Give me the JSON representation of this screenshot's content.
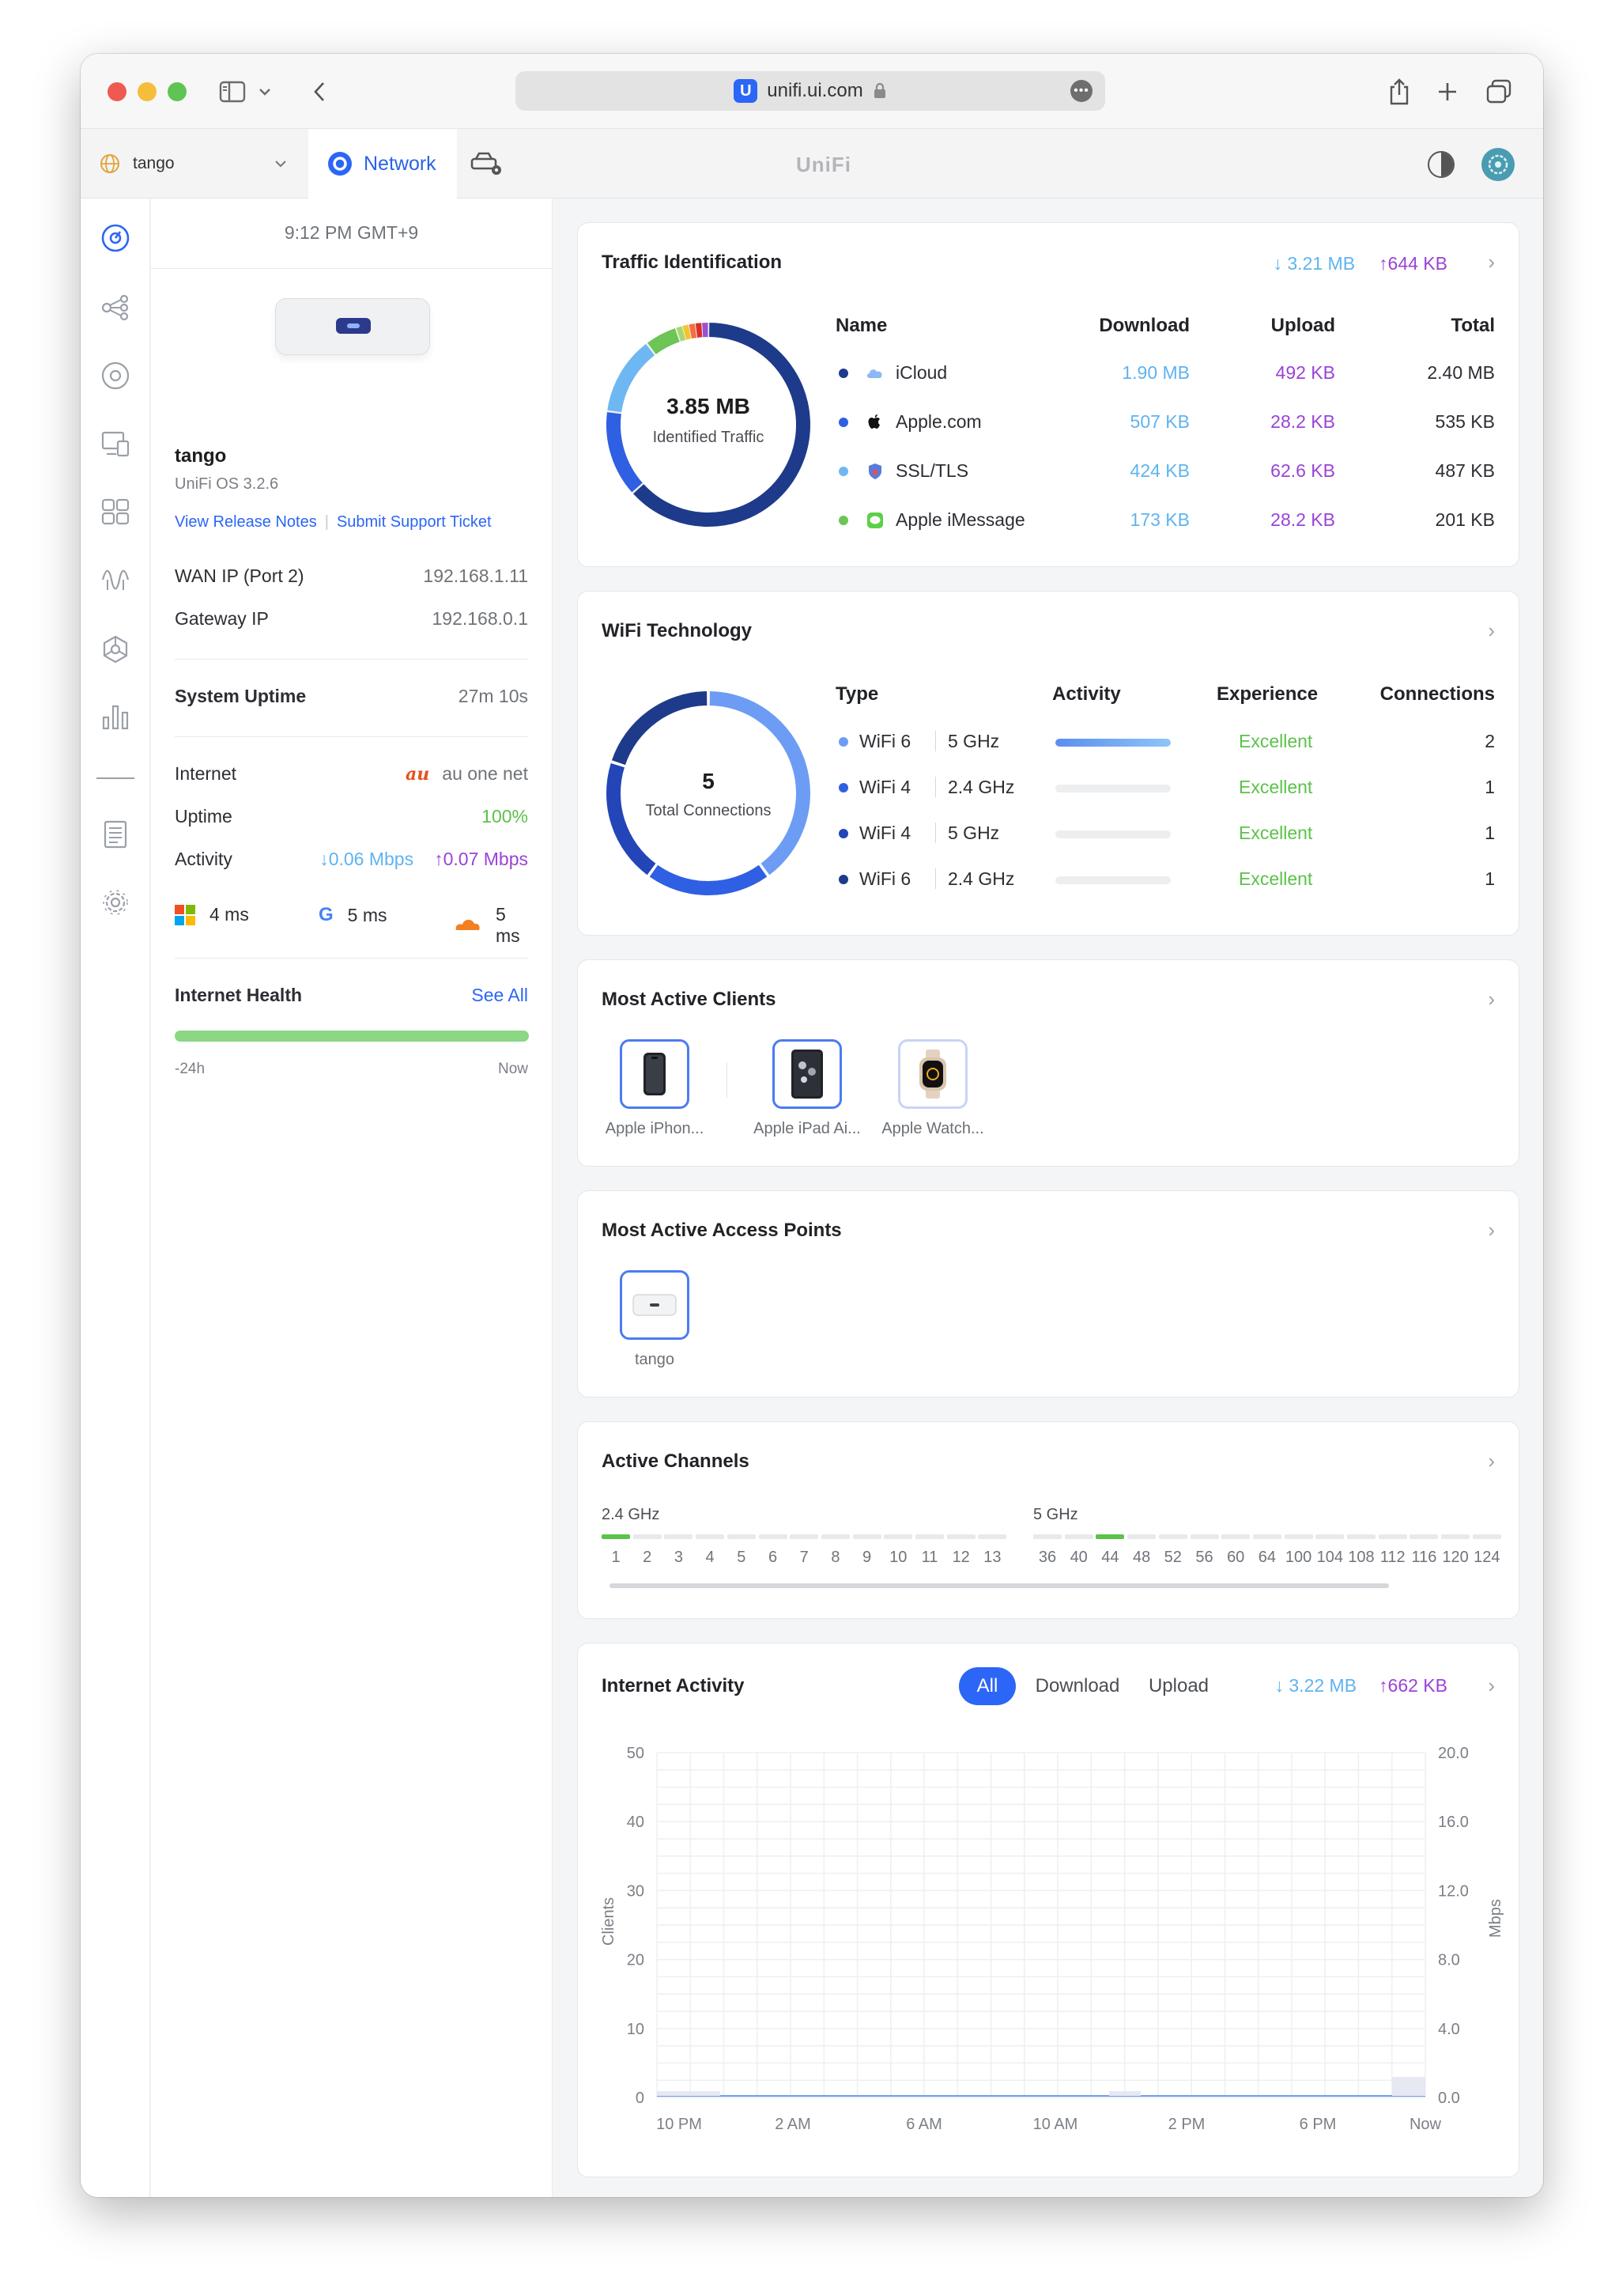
{
  "browser": {
    "url": "unifi.ui.com"
  },
  "topbar": {
    "site": "tango",
    "tab_label": "Network",
    "brand": "UniFi"
  },
  "left": {
    "time": "9:12 PM GMT+9",
    "device_name": "tango",
    "os": "UniFi OS 3.2.6",
    "release_notes": "View Release Notes",
    "support": "Submit Support Ticket",
    "wan_label": "WAN IP (Port 2)",
    "wan_value": "192.168.1.11",
    "gateway_label": "Gateway IP",
    "gateway_value": "192.168.0.1",
    "uptime_label": "System Uptime",
    "uptime_value": "27m 10s",
    "internet_label": "Internet",
    "isp_logo": "au",
    "isp": "au one net",
    "uptime2_label": "Uptime",
    "uptime2_value": "100%",
    "activity_label": "Activity",
    "down": "0.06 Mbps",
    "up": "0.07 Mbps",
    "lat_ms": "4 ms",
    "lat_google": "5 ms",
    "lat_cf": "5 ms",
    "health_label": "Internet Health",
    "see_all": "See All",
    "h_start": "-24h",
    "h_end": "Now",
    "health_pct": 100
  },
  "traffic": {
    "title": "Traffic Identification",
    "down": "3.21 MB",
    "up": "644 KB",
    "center_value": "3.85 MB",
    "center_label": "Identified Traffic",
    "cols": [
      "Name",
      "Download",
      "Upload",
      "Total"
    ],
    "rows": [
      {
        "name": "iCloud",
        "dl": "1.90 MB",
        "ul": "492 KB",
        "total": "2.40 MB",
        "color": "#1e3a8a",
        "icon": "cloud-icon"
      },
      {
        "name": "Apple.com",
        "dl": "507 KB",
        "ul": "28.2 KB",
        "total": "535 KB",
        "color": "#2f5fe3",
        "icon": "apple-icon"
      },
      {
        "name": "SSL/TLS",
        "dl": "424 KB",
        "ul": "62.6 KB",
        "total": "487 KB",
        "color": "#6fb7f2",
        "icon": "shield-icon"
      },
      {
        "name": "Apple iMessage",
        "dl": "173 KB",
        "ul": "28.2 KB",
        "total": "201 KB",
        "color": "#6cc554",
        "icon": "message-icon"
      }
    ]
  },
  "wifi": {
    "title": "WiFi Technology",
    "center_value": "5",
    "center_label": "Total Connections",
    "cols": [
      "Type",
      "Activity",
      "Experience",
      "Connections"
    ],
    "rows": [
      {
        "gen": "WiFi 6",
        "band": "5 GHz",
        "activity": 1.0,
        "exp": "Excellent",
        "conn": "2",
        "color": "#6d9cf4"
      },
      {
        "gen": "WiFi 4",
        "band": "2.4 GHz",
        "activity": 0.0,
        "exp": "Excellent",
        "conn": "1",
        "color": "#2f5fe3"
      },
      {
        "gen": "WiFi 4",
        "band": "5 GHz",
        "activity": 0.0,
        "exp": "Excellent",
        "conn": "1",
        "color": "#2345b8"
      },
      {
        "gen": "WiFi 6",
        "band": "2.4 GHz",
        "activity": 0.0,
        "exp": "Excellent",
        "conn": "1",
        "color": "#1e3a8a"
      }
    ]
  },
  "clients": {
    "title": "Most Active Clients",
    "items": [
      {
        "label": "Apple iPhon...",
        "icon": "iphone-icon"
      },
      {
        "label": "Apple iPad Ai...",
        "icon": "ipad-icon"
      },
      {
        "label": "Apple Watch...",
        "icon": "watch-icon"
      }
    ]
  },
  "aps": {
    "title": "Most Active Access Points",
    "items": [
      {
        "label": "tango",
        "icon": "access-point-icon"
      }
    ]
  },
  "channels": {
    "title": "Active Channels",
    "band24": "2.4 GHz",
    "band5": "5 GHz",
    "ch24": [
      "1",
      "2",
      "3",
      "4",
      "5",
      "6",
      "7",
      "8",
      "9",
      "10",
      "11",
      "12",
      "13"
    ],
    "ch5": [
      "36",
      "40",
      "44",
      "48",
      "52",
      "56",
      "60",
      "64",
      "100",
      "104",
      "108",
      "112",
      "116",
      "120",
      "124"
    ],
    "active24": [
      "1"
    ],
    "active5": [
      "44"
    ]
  },
  "activity": {
    "title": "Internet Activity",
    "filters": [
      "All",
      "Download",
      "Upload"
    ],
    "active_filter": "All",
    "down": "3.22 MB",
    "up": "662 KB",
    "y_left_label": "Clients",
    "y_right_label": "Mbps",
    "y_left": [
      "50",
      "40",
      "30",
      "20",
      "10",
      "0"
    ],
    "y_right": [
      "20.0",
      "16.0",
      "12.0",
      "8.0",
      "4.0",
      "0.0"
    ],
    "x": [
      "10 PM",
      "2 AM",
      "6 AM",
      "10 AM",
      "2 PM",
      "6 PM",
      "Now"
    ]
  },
  "colors": {
    "accent": "#2b66f6",
    "download": "#5fb3f0",
    "upload": "#9a43d6",
    "good": "#5bc24a"
  }
}
